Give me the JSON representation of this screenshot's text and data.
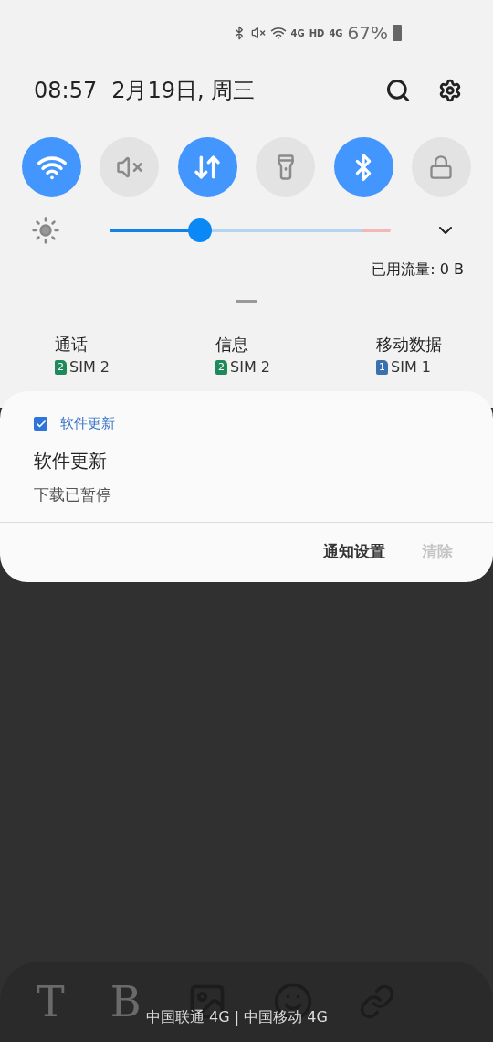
{
  "status_bar": {
    "network_labels": [
      "4G",
      "HD",
      "4G"
    ],
    "battery": "67%"
  },
  "header": {
    "time": "08:57",
    "date": "2月19日, 周三"
  },
  "toggles": [
    {
      "kind": "wifi",
      "on": true
    },
    {
      "kind": "sound",
      "on": false
    },
    {
      "kind": "data",
      "on": true
    },
    {
      "kind": "flashlight",
      "on": false
    },
    {
      "kind": "bluetooth",
      "on": true
    },
    {
      "kind": "rotation",
      "on": false
    }
  ],
  "brightness": {
    "level": 0.32
  },
  "data_usage": "已用流量: 0 B",
  "sim_settings": [
    {
      "label": "通话",
      "sim_number": "2",
      "sim": "SIM 2",
      "color": "#1e8a5a"
    },
    {
      "label": "信息",
      "sim_number": "2",
      "sim": "SIM 2",
      "color": "#1e8a5a"
    },
    {
      "label": "移动数据",
      "sim_number": "1",
      "sim": "SIM 1",
      "color": "#3a6fb0"
    }
  ],
  "notification": {
    "app": "软件更新",
    "title": "软件更新",
    "text": "下载已暂停",
    "actions": [
      {
        "label": "通知设置",
        "disabled": false
      },
      {
        "label": "清除",
        "disabled": true
      }
    ]
  },
  "background_toolbar": [
    {
      "kind": "text",
      "label": "T"
    },
    {
      "kind": "text",
      "label": "B"
    },
    {
      "kind": "image"
    },
    {
      "kind": "emoji"
    },
    {
      "kind": "link"
    }
  ],
  "carrier": "中国联通 4G | 中国移动 4G"
}
